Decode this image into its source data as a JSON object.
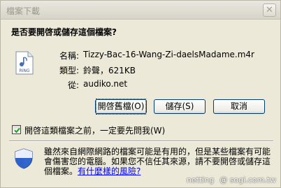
{
  "window": {
    "title": "檔案下載",
    "close_glyph": "✕"
  },
  "heading": "是否要開啓或儲存這個檔案?",
  "file_icon": {
    "name": "audio-file-icon",
    "caption": "RING"
  },
  "info": {
    "name_label": "名稱:",
    "name_value": "Tizzy-Bac-16-Wang-Zi-daelsMadame.m4r",
    "type_label": "類型:",
    "type_value": "鈴聲，621KB",
    "from_label": "從:",
    "from_value": "audiko.net"
  },
  "buttons": {
    "open": "開啓舊檔(O)",
    "save": "儲存(S)",
    "cancel": "取消"
  },
  "checkbox": {
    "label": "開啓這類檔案之前，一定要先問我(W)",
    "checked": true
  },
  "warning": {
    "text": "雖然來自網際網路的檔案可能是有用的，但是某些檔案有可能會傷害您的電腦。如果您不信任其來源，請不要開啓或儲存這個檔案。",
    "link": "有什麼樣的風險?"
  },
  "watermark": {
    "left": "netting",
    "right": "@ sogi.com.tw"
  },
  "colors": {
    "link": "#0000ff",
    "dialog_bg": "#ece9d8",
    "button_border": "#003c74"
  }
}
